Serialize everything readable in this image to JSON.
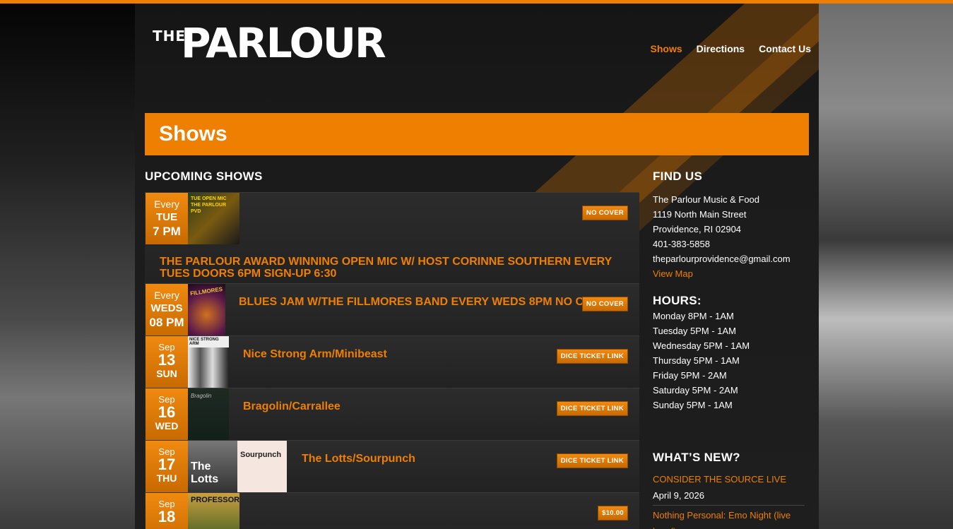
{
  "site": {
    "logo_small": "THE",
    "logo_main": "PARLOUR"
  },
  "nav": [
    {
      "label": "Shows",
      "active": true
    },
    {
      "label": "Directions",
      "active": false
    },
    {
      "label": "Contact Us",
      "active": false
    }
  ],
  "page_title": "Shows",
  "upcoming_title": "UPCOMING SHOWS",
  "shows": [
    {
      "date_l1": "Every",
      "date_l2": "TUE",
      "date_l3": "7 PM",
      "title": "THE PARLOUR AWARD WINNING OPEN MIC W/ HOST CORINNE SOUTHERN EVERY TUES DOORS 6PM SIGN-UP 6:30",
      "badge": "NO COVER",
      "poster_text": "TUE OPEN MIC THE PARLOUR PVD"
    },
    {
      "date_l1": "Every",
      "date_l2": "WEDS",
      "date_l3": "08 PM",
      "title": "BLUES JAM W/THE FILLMORES BAND EVERY WEDS 8PM NO COVER",
      "badge": "NO COVER",
      "poster_text": "FILLMORES"
    },
    {
      "date_l1": "Sep",
      "date_l2": "13",
      "date_l3": "SUN",
      "title": "Nice Strong Arm/Minibeast",
      "badge": "DICE TICKET LINK",
      "poster_text": "NICE STRONG ARM"
    },
    {
      "date_l1": "Sep",
      "date_l2": "16",
      "date_l3": "WED",
      "title": "Bragolin/Carrallee",
      "badge": "DICE TICKET LINK",
      "poster_text": "Bragolin"
    },
    {
      "date_l1": "Sep",
      "date_l2": "17",
      "date_l3": "THU",
      "title": "The Lotts/Sourpunch",
      "badge": "DICE TICKET LINK",
      "poster_text": "The Lotts",
      "poster2_text": "Sourpunch"
    },
    {
      "date_l1": "Sep",
      "date_l2": "18",
      "date_l3": "",
      "title": "",
      "badge": "$10.00",
      "poster_text": "PROFESSOR"
    }
  ],
  "find_us": {
    "title": "FIND US",
    "name": "The Parlour Music & Food",
    "street": "1119 North Main Street",
    "city": "Providence, RI 02904",
    "phone": "401-383-5858",
    "email": "theparlourprovidence@gmail.com",
    "map_link": "View Map"
  },
  "hours": {
    "title": "HOURS:",
    "lines": [
      "Monday 8PM - 1AM",
      "Tuesday 5PM - 1AM",
      "Wednesday 5PM - 1AM",
      "Thursday 5PM - 1AM",
      "Friday 5PM - 2AM",
      "Saturday 5PM - 2AM",
      "Sunday 5PM - 1AM"
    ]
  },
  "news": {
    "title": "WHAT’S NEW?",
    "items": [
      {
        "link": "CONSIDER THE SOURCE LIVE",
        "date": "April 9, 2026"
      },
      {
        "link": "Nothing Personal: Emo Night (live band)",
        "date": ""
      }
    ]
  },
  "colors": {
    "accent": "#ee7f00",
    "bg": "#1b1b1b"
  }
}
